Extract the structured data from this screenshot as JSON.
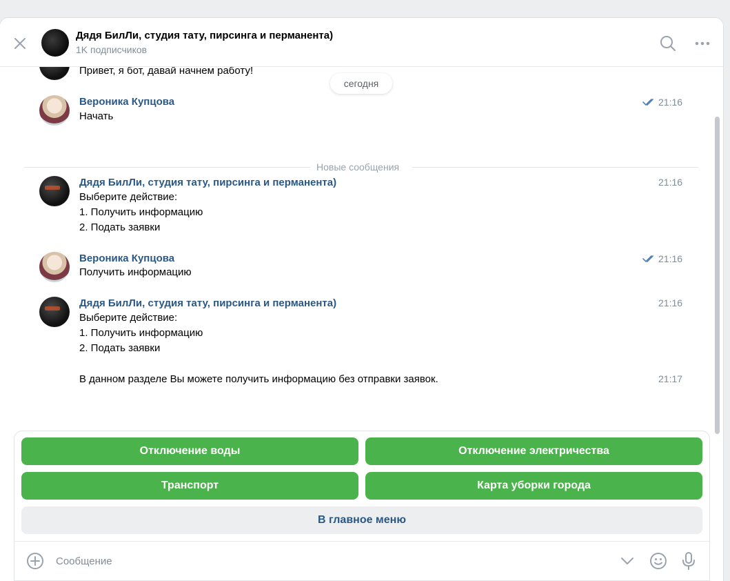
{
  "header": {
    "title": "Дядя БилЛи, студия тату, пирсинга и перманента)",
    "subtitle": "1K подписчиков"
  },
  "date_label": "сегодня",
  "new_messages_label": "Новые сообщения",
  "messages": {
    "prev_bot_text": "Привет, я бот, давай начнем работу!",
    "m1": {
      "name": "Вероника Купцова",
      "time": "21:16",
      "text": "Начать"
    },
    "m2": {
      "name": "Дядя БилЛи, студия тату, пирсинга и перманента)",
      "time": "21:16",
      "lines": [
        "Выберите действие:",
        "1. Получить информацию",
        "2. Подать заявки"
      ]
    },
    "m3": {
      "name": "Вероника Купцова",
      "time": "21:16",
      "text": "Получить информацию"
    },
    "m4": {
      "name": "Дядя БилЛи, студия тату, пирсинга и перманента)",
      "time": "21:16",
      "lines": [
        "Выберите действие:",
        "1. Получить информацию",
        "2. Подать заявки"
      ]
    },
    "m5": {
      "time": "21:17",
      "text": "В данном разделе Вы можете получить информацию без отправки заявок."
    }
  },
  "keyboard": {
    "water": "Отключение воды",
    "electricity": "Отключение электричества",
    "transport": "Транспорт",
    "cleaning_map": "Карта уборки города",
    "main_menu": "В главное меню"
  },
  "composer": {
    "placeholder": "Сообщение"
  },
  "colors": {
    "accent": "#2a5885",
    "button_green": "#4bb34b",
    "muted": "#818c99"
  },
  "icons": [
    "close-icon",
    "search-icon",
    "more-icon",
    "double-check-icon",
    "attach-icon",
    "chevron-down-icon",
    "emoji-icon",
    "microphone-icon"
  ]
}
